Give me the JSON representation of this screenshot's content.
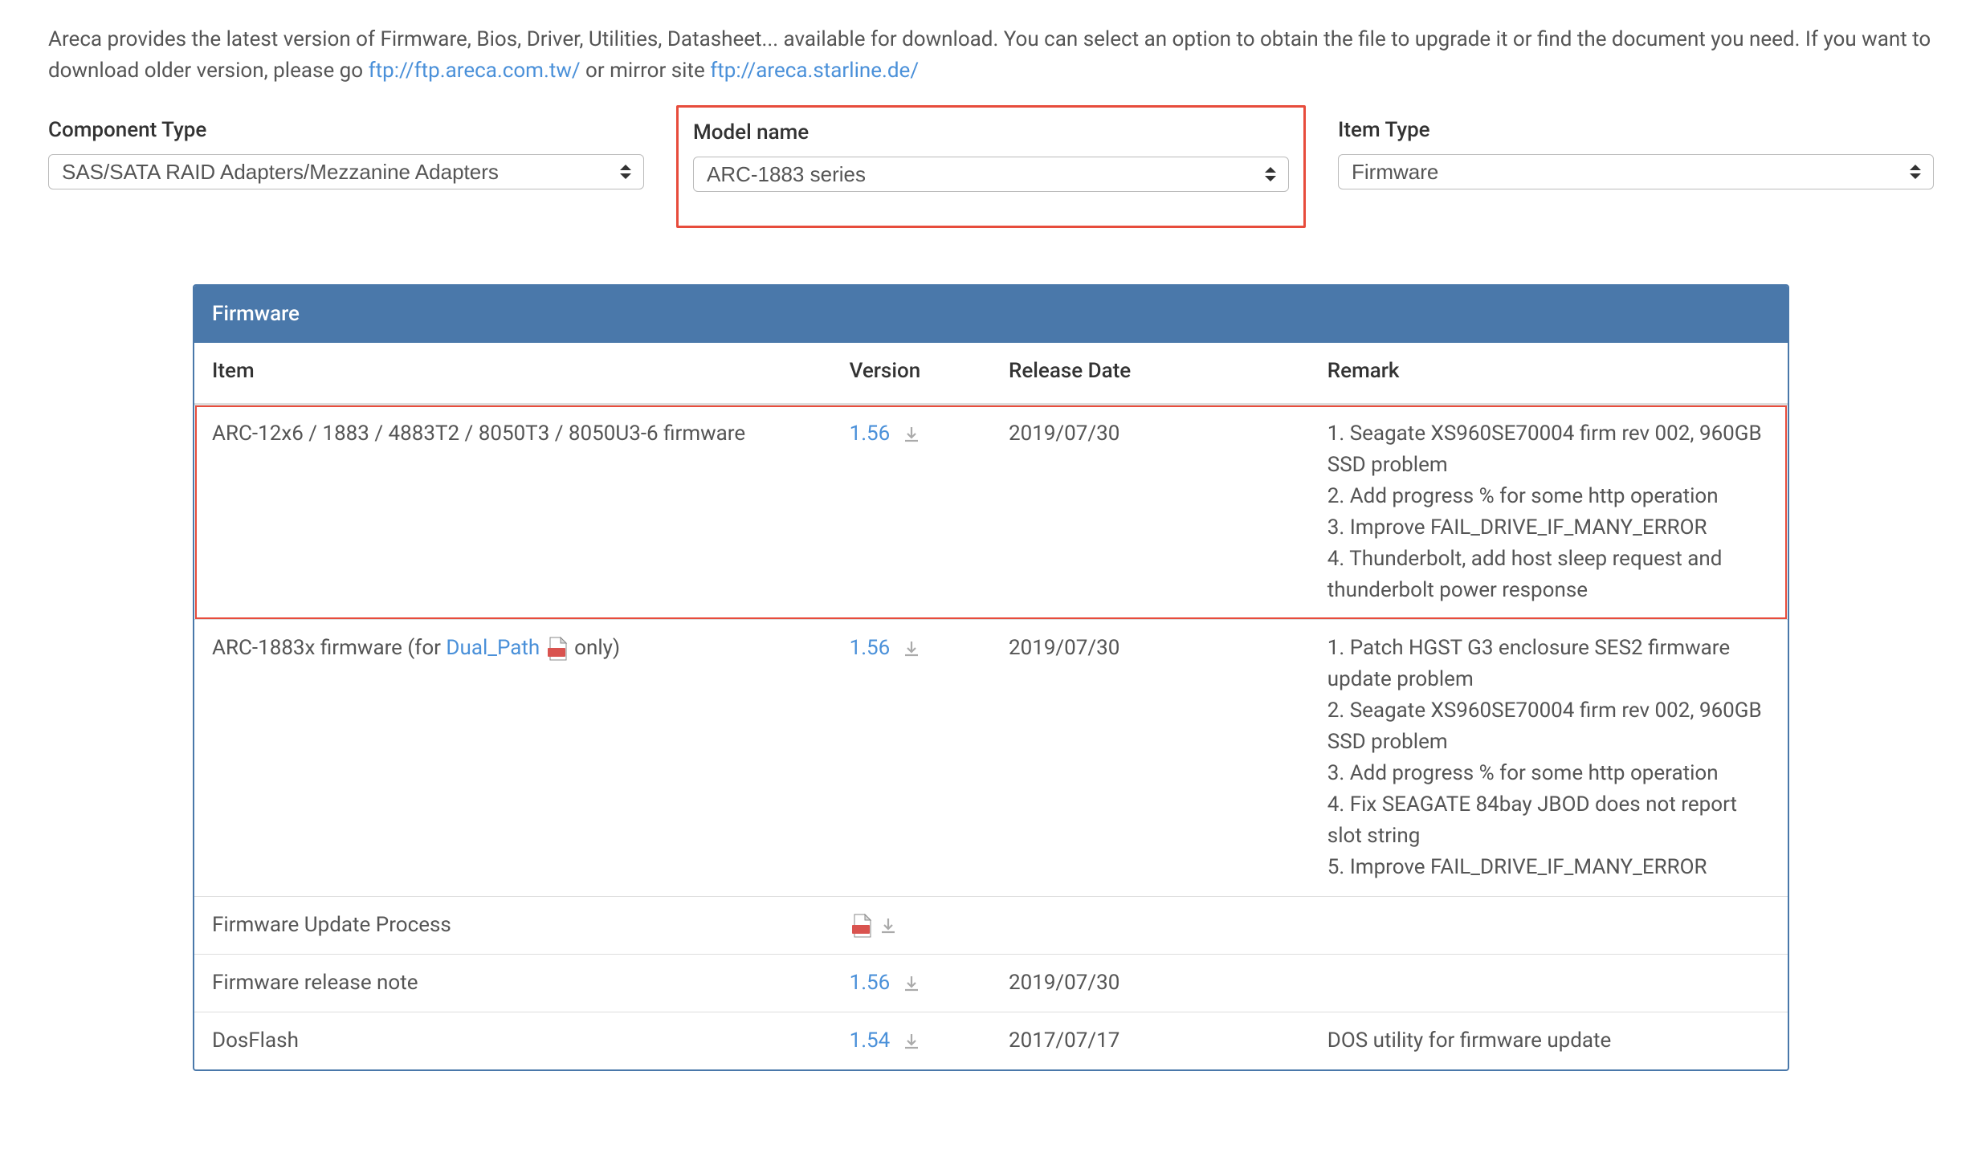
{
  "intro": {
    "text_a": "Areca provides the latest version of Firmware, Bios, Driver, Utilities, Datasheet... available for download. You can select an option to obtain the file to upgrade it or find the document you need. If you want to download older version, please go ",
    "link1": "ftp://ftp.areca.com.tw/",
    "text_b": " or mirror site ",
    "link2": "ftp://areca.starline.de/"
  },
  "filters": {
    "component": {
      "label": "Component Type",
      "value": "SAS/SATA RAID Adapters/Mezzanine Adapters"
    },
    "model": {
      "label": "Model name",
      "value": "ARC-1883 series"
    },
    "itemtype": {
      "label": "Item Type",
      "value": "Firmware"
    }
  },
  "panel": {
    "title": "Firmware",
    "columns": {
      "item": "Item",
      "version": "Version",
      "date": "Release Date",
      "remark": "Remark"
    },
    "rows": [
      {
        "highlight": true,
        "item_plain": "ARC-12x6 / 1883 / 4883T2 / 8050T3 / 8050U3-6 firmware",
        "version": "1.56",
        "date": "2019/07/30",
        "remark": "1. Seagate XS960SE70004 firm rev 002, 960GB SSD problem\n2. Add progress % for some http operation\n3. Improve FAIL_DRIVE_IF_MANY_ERROR\n4. Thunderbolt, add host sleep request and thunderbolt power response"
      },
      {
        "item_prefix": "ARC-1883x firmware (for ",
        "item_link": "Dual_Path",
        "item_suffix": "  only)",
        "has_pdf_inline": true,
        "version": "1.56",
        "date": "2019/07/30",
        "remark": "1. Patch HGST G3 enclosure SES2 firmware update problem\n2. Seagate XS960SE70004 firm rev 002, 960GB SSD problem\n3. Add progress % for some http operation\n4. Fix SEAGATE 84bay JBOD does not report slot string\n5. Improve FAIL_DRIVE_IF_MANY_ERROR"
      },
      {
        "item_plain": "Firmware Update Process",
        "pdf_only": true,
        "version": "",
        "date": "",
        "remark": ""
      },
      {
        "item_plain": "Firmware release note",
        "version": "1.56",
        "date": "2019/07/30",
        "remark": ""
      },
      {
        "item_plain": "DosFlash",
        "version": "1.54",
        "date": "2017/07/17",
        "remark": "DOS utility for firmware update"
      }
    ]
  }
}
